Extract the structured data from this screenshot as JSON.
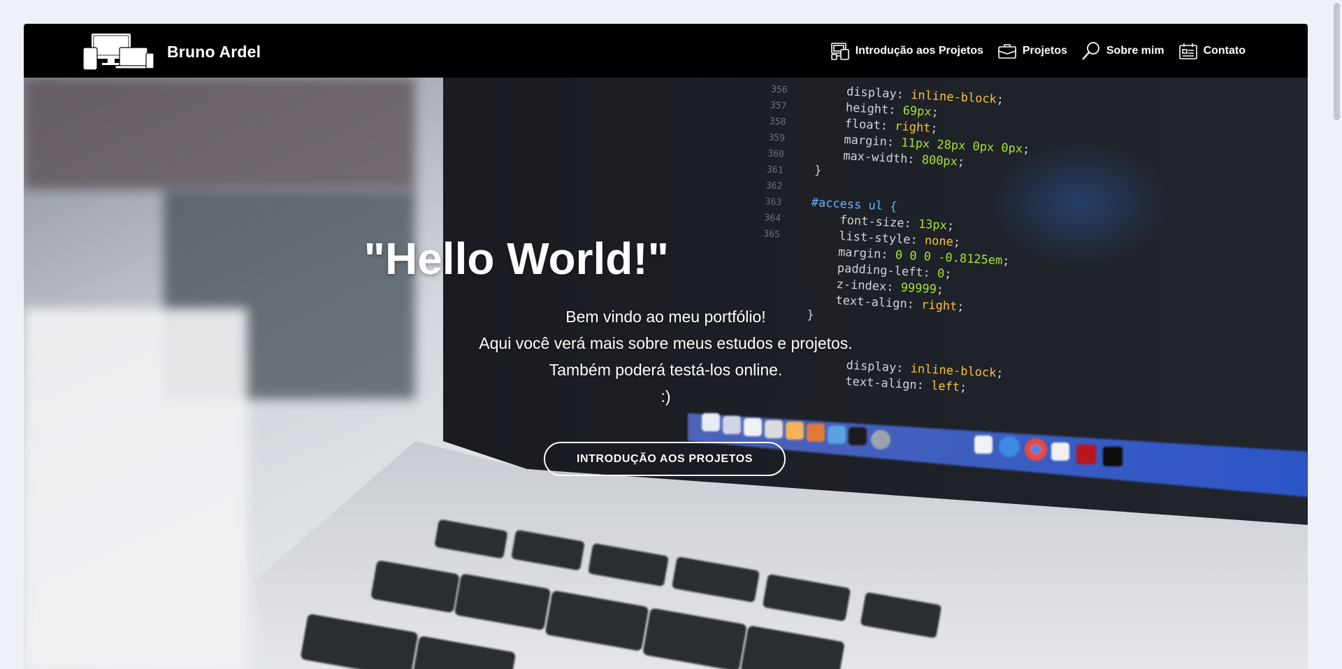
{
  "brand": {
    "name": "Bruno Ardel"
  },
  "nav": {
    "items": [
      {
        "label": "Introdução aos Projetos",
        "icon": "devices-icon"
      },
      {
        "label": "Projetos",
        "icon": "briefcase-icon"
      },
      {
        "label": "Sobre mim",
        "icon": "magnifier-icon"
      },
      {
        "label": "Contato",
        "icon": "contact-card-icon"
      }
    ]
  },
  "hero": {
    "title": "\"Hello World!\"",
    "lines": [
      "Bem vindo ao meu portfólio!",
      "Aqui você verá mais sobre meus estudos e projetos.",
      "Também poderá testá-los online.",
      ":)"
    ],
    "button_label": "INTRODUÇÃO AOS PROJETOS"
  },
  "code_lines": {
    "numbers": [
      "356",
      "357",
      "358",
      "359",
      "360",
      "361",
      "362",
      "363",
      "364",
      "365"
    ],
    "l1_prop": "display:",
    "l1_val": "inline-block",
    "l2_prop": "height:",
    "l2_val": "69px",
    "l3_prop": "float:",
    "l3_val": "right",
    "l4_prop": "margin:",
    "l4_val": "11px 28px 0px 0px",
    "l5_prop": "max-width:",
    "l5_val": "800px",
    "selector": "#access ul {",
    "l6_prop": "font-size:",
    "l6_val": "13px",
    "l7_prop": "list-style:",
    "l7_val": "none",
    "l8_prop": "margin:",
    "l8_val": "0 0 0 -0.8125em",
    "l9_prop": "padding-left:",
    "l9_val": "0",
    "l10_prop": "z-index:",
    "l10_val": "99999",
    "l11_prop": "text-align:",
    "l11_val": "right",
    "l12_prop": "display:",
    "l12_val": "inline-block",
    "l13_prop": "text-align:",
    "l13_val": "left"
  },
  "colors": {
    "navbar_bg": "#000000",
    "page_bg": "#eef1f8",
    "text_light": "#ffffff"
  }
}
